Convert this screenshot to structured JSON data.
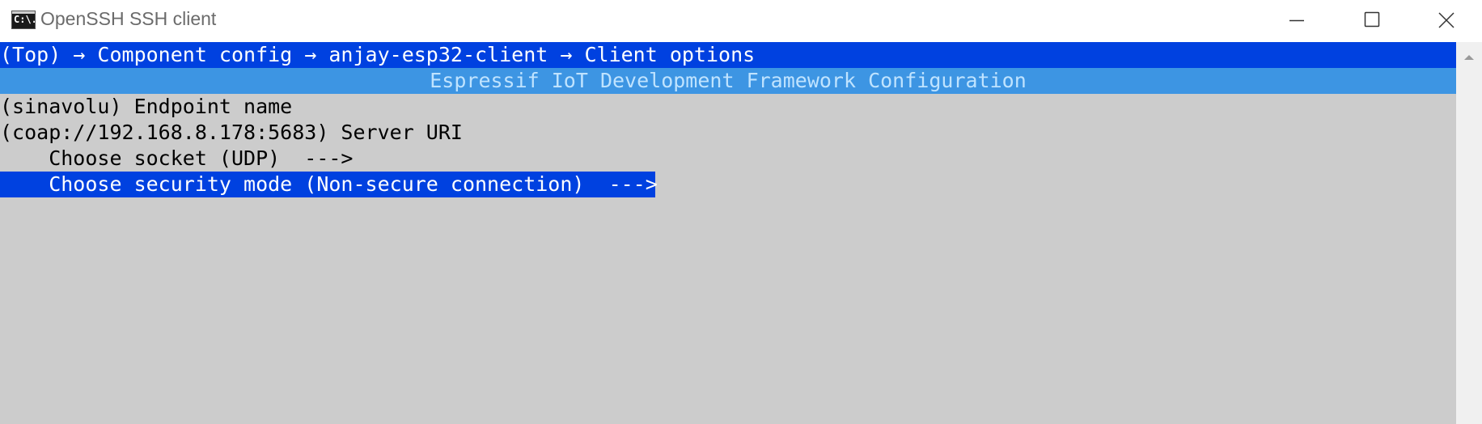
{
  "window": {
    "title": "OpenSSH SSH client",
    "icon_label": "C:\\."
  },
  "controls": {
    "minimize_icon": "minimize-icon",
    "maximize_icon": "maximize-icon",
    "close_icon": "close-icon"
  },
  "terminal": {
    "breadcrumb": "(Top) → Component config → anjay-esp32-client → Client options",
    "header": "Espressif IoT Development Framework Configuration",
    "items": [
      {
        "text": "(sinavolu) Endpoint name"
      },
      {
        "text": "(coap://192.168.8.178:5683) Server URI"
      },
      {
        "text": "    Choose socket (UDP)  --->"
      },
      {
        "text": "    Choose security mode (Non-secure connection)  --->"
      }
    ],
    "selected_index": 3
  },
  "colors": {
    "terminal_bg": "#cccccc",
    "breadcrumb_bg": "#0041e0",
    "header_bg": "#3d95e3",
    "header_text": "#bfe3ff",
    "selection_bg": "#0041e0"
  }
}
